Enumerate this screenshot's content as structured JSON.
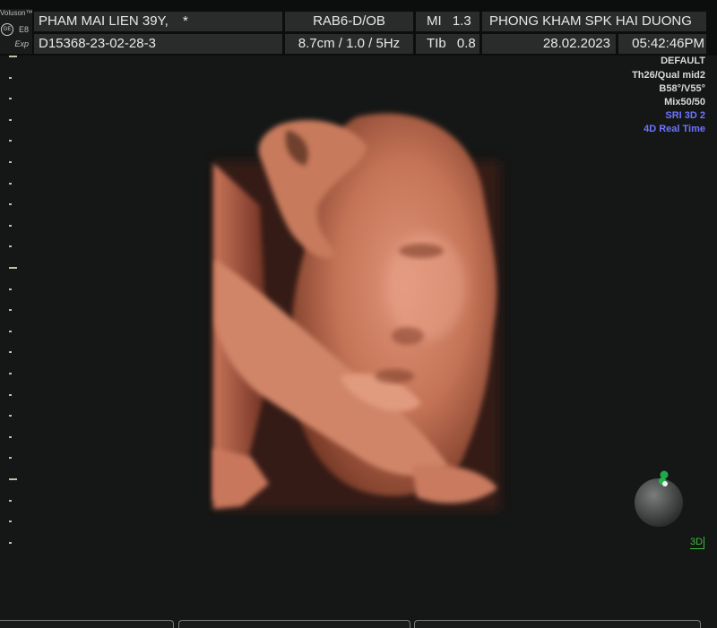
{
  "header": {
    "brand_name": "Voluson™",
    "logo_text": "GE",
    "model": "E8",
    "exp_label": "Exp",
    "patient_name": "PHAM MAI LIEN 39Y,",
    "patient_flag": "*",
    "exam_id": "D15368-23-02-28-3",
    "probe": "RAB6-D/OB",
    "probe_settings": "8.7cm / 1.0 /  5Hz",
    "mi_label": "MI",
    "mi_value": "1.3",
    "tib_label": "TIb",
    "tib_value": "0.8",
    "institution": "PHONG KHAM SPK HAI DUONG",
    "date": "28.02.2023",
    "time": "05:42:46PM"
  },
  "settings": {
    "preset": "DEFAULT",
    "threshold_quality": "Th26/Qual mid2",
    "box_angles": "B58°/V55°",
    "mix": "Mix50/50",
    "sri": "SRI 3D 2",
    "mode": "4D Real Time"
  },
  "orientation": {
    "mode_label": "3D"
  },
  "colors": {
    "header_cell": "#2a2c2c",
    "info_blue": "#6d74ff",
    "mode_green": "#3cbb3c",
    "tissue": "#c87a58"
  },
  "icons": {
    "logo": "ge-logo-icon",
    "orientation": "orientation-ball-icon",
    "marker": "orientation-marker-icon"
  }
}
